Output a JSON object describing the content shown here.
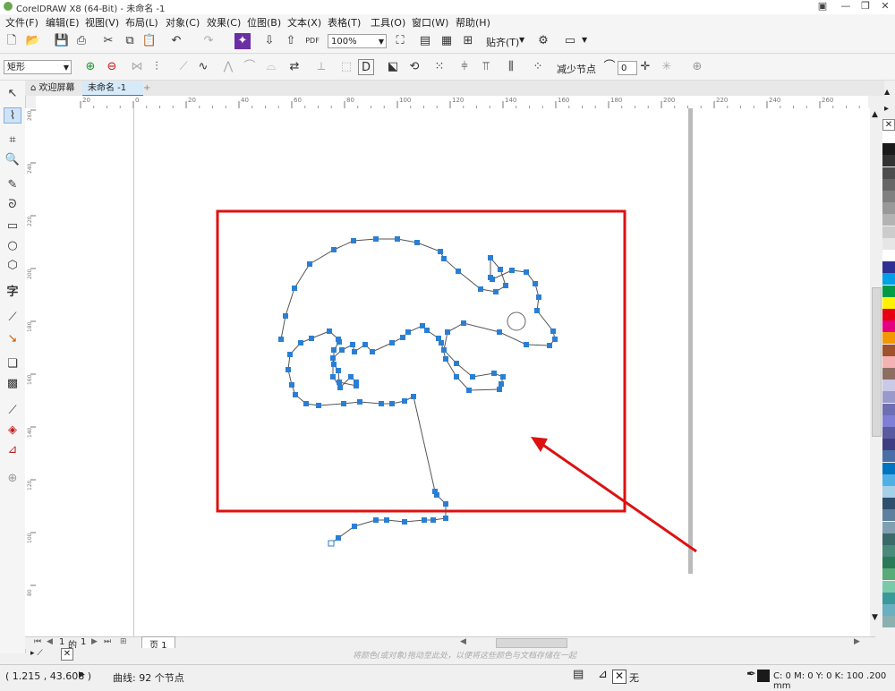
{
  "window": {
    "title": "CorelDRAW X8 (64-Bit) - 未命名 -1",
    "min_label": "—",
    "max_label": "❐",
    "close_label": "✕"
  },
  "menu": [
    "文件(F)",
    "编辑(E)",
    "视图(V)",
    "布局(L)",
    "对象(C)",
    "效果(C)",
    "位图(B)",
    "文本(X)",
    "表格(T)",
    "工具(O)",
    "窗口(W)",
    "帮助(H)"
  ],
  "toolbar": {
    "zoom": "100%",
    "snap_label": "贴齐(T)"
  },
  "propertybar": {
    "shape_select": "矩形",
    "reduce_nodes": "减少节点",
    "smoothness": "0"
  },
  "tabs": [
    {
      "label": "欢迎屏幕"
    },
    {
      "label": "未命名 -1"
    }
  ],
  "rulers": {
    "h": [
      "20",
      "0",
      "20",
      "40",
      "60",
      "80",
      "100",
      "120",
      "140",
      "160",
      "180",
      "200",
      "220",
      "240",
      "260"
    ],
    "v": [
      "260",
      "240",
      "220",
      "200",
      "180",
      "160",
      "140",
      "120",
      "100",
      "80",
      "60"
    ]
  },
  "pages": {
    "current": "1",
    "of_label": "的",
    "total": "1",
    "tab_label": "页 1"
  },
  "hint_text": "将颜色(或对象)拖动至此处，以便将这些颜色与文档存储在一起",
  "status": {
    "coords": "( 1.215 , 43.608 )",
    "selection": "曲线: 92 个节点",
    "fill_label": "无",
    "color_info": "C: 0 M: 0 Y: 0 K: 100  .200 mm"
  },
  "colors": {
    "annotation": "#dd1111",
    "node": "#2a7fd4",
    "palette": [
      "#ffffff",
      "#1a1a1a",
      "#333333",
      "#4d4d4d",
      "#666666",
      "#808080",
      "#999999",
      "#b3b3b3",
      "#cccccc",
      "#e6e6e6",
      "#ffffff",
      "#2e3192",
      "#00a0e9",
      "#009944",
      "#fff100",
      "#e60012",
      "#e4007f",
      "#f39800",
      "#a0522d",
      "#f5b2b2",
      "#8c6e63",
      "#c9c9e8",
      "#9999cc",
      "#6e6eb4",
      "#7f7fd6",
      "#5a5aa0",
      "#3f3f80",
      "#4a6fa5",
      "#0074c1",
      "#4fb0e8",
      "#a6cfe8",
      "#2f4f6f",
      "#5f7f9f",
      "#7fa0b0",
      "#3a6a6a",
      "#4a8a7a",
      "#2a7a5a",
      "#5aaa7a",
      "#7acaaa",
      "#3a9a9a",
      "#6ab0c0",
      "#8ab0b0"
    ]
  }
}
